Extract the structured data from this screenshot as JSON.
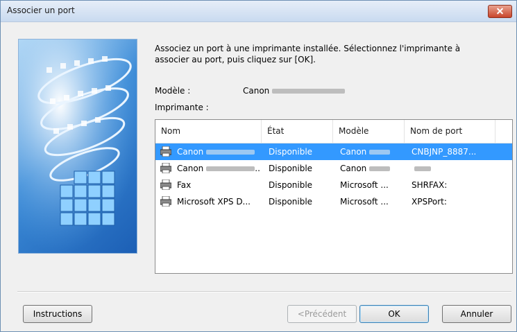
{
  "window": {
    "title": "Associer un port"
  },
  "content": {
    "intro": "Associez un port à une imprimante installée. Sélectionnez l'imprimante à associer au port, puis cliquez sur [OK].",
    "model_label": "Modèle :",
    "model_value": "Canon",
    "printer_label": "Imprimante :"
  },
  "table": {
    "columns": [
      "Nom",
      "État",
      "Modèle",
      "Nom de port"
    ],
    "rows": [
      {
        "name": "Canon",
        "state": "Disponible",
        "model": "Canon",
        "port": "CNBJNP_8887...",
        "selected": true
      },
      {
        "name": "Canon",
        "state": "Disponible",
        "model": "Canon",
        "port": "",
        "selected": false
      },
      {
        "name": "Fax",
        "state": "Disponible",
        "model": "Microsoft ...",
        "port": "SHRFAX:",
        "selected": false
      },
      {
        "name": "Microsoft XPS D...",
        "state": "Disponible",
        "model": "Microsoft ...",
        "port": "XPSPort:",
        "selected": false
      }
    ]
  },
  "buttons": {
    "instructions": "Instructions",
    "previous": "<Précédent",
    "ok": "OK",
    "cancel": "Annuler"
  }
}
